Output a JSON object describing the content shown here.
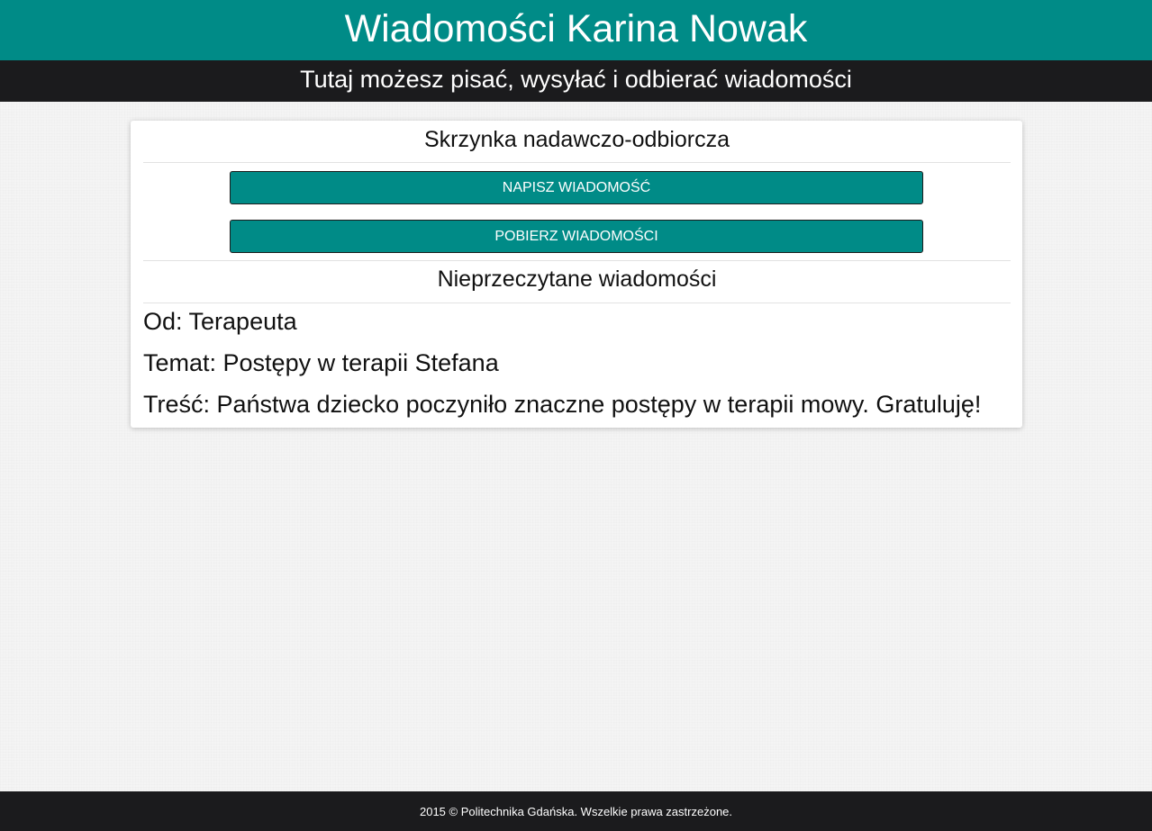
{
  "header": {
    "title": "Wiadomości Karina Nowak",
    "subtitle": "Tutaj możesz pisać, wysyłać i odbierać wiadomości"
  },
  "mailbox": {
    "title": "Skrzynka nadawczo-odbiorcza",
    "write_button": "Napisz wiadomość",
    "fetch_button": "Pobierz wiadomości"
  },
  "unread": {
    "title": "Nieprzeczytane wiadomości",
    "message": {
      "from": "Od: Terapeuta",
      "subject": "Temat: Postępy w terapii Stefana",
      "body": "Treść: Państwa dziecko poczyniło znaczne postępy w terapii mowy. Gratuluję!"
    }
  },
  "footer": {
    "text": "2015 © Politechnika Gdańska. Wszelkie prawa zastrzeżone."
  },
  "colors": {
    "accent": "#008b87",
    "dark": "#1b1b1d",
    "background": "#f4f4f4"
  }
}
